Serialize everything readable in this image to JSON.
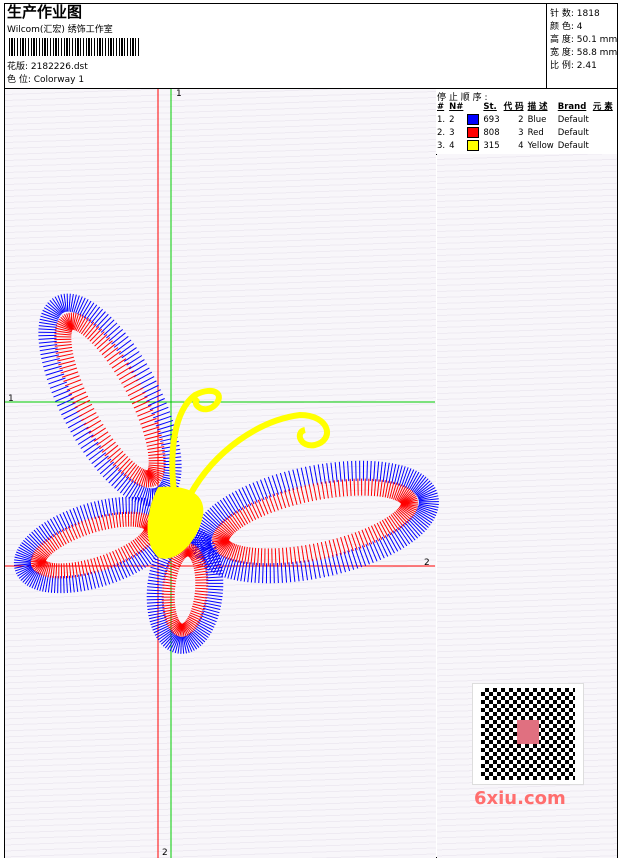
{
  "header": {
    "title": "生产作业图",
    "studio": "Wilcom(汇宏) 绣饰工作室",
    "design_label": "花版: 2182226.dst",
    "colorway_label": "色 位:  Colorway 1"
  },
  "stats": [
    {
      "label": "针 数:",
      "value": "1818"
    },
    {
      "label": "颜 色:",
      "value": "4"
    },
    {
      "label": "高 度:",
      "value": "50.1 mm"
    },
    {
      "label": "宽 度:",
      "value": "58.8 mm"
    },
    {
      "label": "比 例:",
      "value": "2.41"
    }
  ],
  "stop_sequence": {
    "title": "停 止 顺 序 :",
    "headers": [
      "#",
      "N#",
      "St.",
      "代 码",
      "描 述",
      "Brand",
      "元 素"
    ],
    "rows": [
      {
        "idx": "1.",
        "n": "2",
        "color": "#0000ff",
        "st": "693",
        "code": "2",
        "desc": "Blue",
        "brand": "Default"
      },
      {
        "idx": "2.",
        "n": "3",
        "color": "#ff0000",
        "st": "808",
        "code": "3",
        "desc": "Red",
        "brand": "Default"
      },
      {
        "idx": "3.",
        "n": "4",
        "color": "#ffff00",
        "st": "315",
        "code": "4",
        "desc": "Yellow",
        "brand": "Default"
      }
    ]
  },
  "axes": {
    "top_label": "1",
    "left_label": "1",
    "right_label": "2",
    "bottom_label": "2"
  },
  "colors": {
    "blue": "#0000ff",
    "red": "#ff0000",
    "yellow": "#ffff00",
    "green": "#00cc00",
    "crosshair_red": "#ff0000"
  },
  "watermark": {
    "text": "6xiu.com"
  }
}
